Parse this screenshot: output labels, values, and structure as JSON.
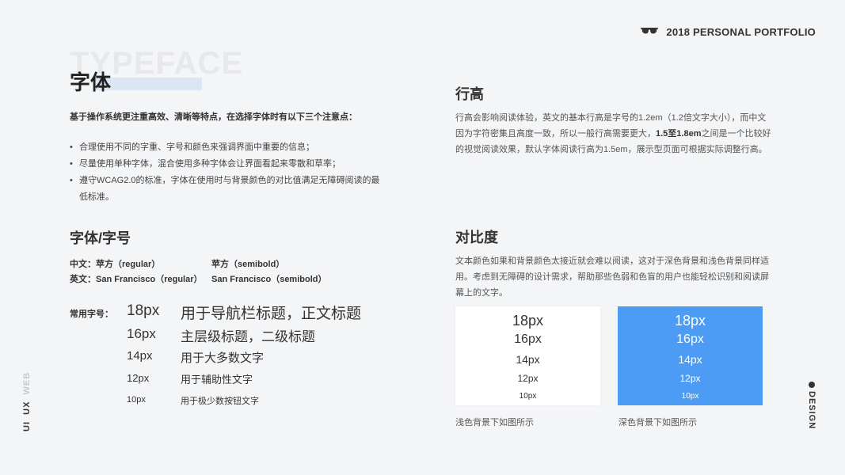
{
  "header": {
    "brand": "2018 PERSONAL PORTFOLIO",
    "logo_icon": "sunglasses-icon"
  },
  "left": {
    "bg_word": "TYPEFACE",
    "title": "字体",
    "intro": "基于操作系统更注重高效、清晰等特点，在选择字体时有以下三个注意点：",
    "bullets": [
      "合理使用不同的字重、字号和颜色来强调界面中重要的信息；",
      "尽量使用单种字体，混合使用多种字体会让界面看起来零散和草率；",
      "遵守WCAG2.0的标准，字体在使用时与背景颜色的对比值满足无障碍阅读的最低标准。"
    ],
    "font_section_title": "字体/字号",
    "font_rows": [
      {
        "a": "中文：苹方（regular）",
        "b": "苹方（semibold）"
      },
      {
        "a": "英文：San Francisco（regular）",
        "b": "San Francisco（semibold）"
      }
    ],
    "common_label": "常用字号：",
    "sizes": [
      {
        "size": "18px",
        "desc": "用于导航栏标题，正文标题"
      },
      {
        "size": "16px",
        "desc": "主层级标题，二级标题"
      },
      {
        "size": "14px",
        "desc": "用于大多数文字"
      },
      {
        "size": "12px",
        "desc": "用于辅助性文字"
      },
      {
        "size": "10px",
        "desc": "用于极少数按钮文字"
      }
    ]
  },
  "right": {
    "line_height_title": "行高",
    "line_height_text_1": "行高会影响阅读体验，英文的基本行高是字号的1.2em（1.2倍文字大小），而中文因为字符密集且高度一致，所以一般行高需要更大，",
    "line_height_bold": "1.5至1.8em",
    "line_height_text_2": "之间是一个比较好的视觉阅读效果，默认字体阅读行高为1.5em，展示型页面可根据实际调整行高。",
    "contrast_title": "对比度",
    "contrast_text": "文本颜色如果和背景颜色太接近就会难以阅读，这对于深色背景和浅色背景同样适用。考虑到无障碍的设计需求，帮助那些色弱和色盲的用户也能轻松识别和阅读屏幕上的文字。",
    "demo_sizes": [
      "18px",
      "16px",
      "14px",
      "12px",
      "10px"
    ],
    "caption_light": "浅色背景下如图所示",
    "caption_dark": "深色背景下如图所示",
    "light_bg": "#ffffff",
    "dark_bg": "#4c9bf4"
  },
  "side": {
    "left_1": "UI",
    "left_2": "UX",
    "left_3": "WEB",
    "right": "DESIGN"
  }
}
